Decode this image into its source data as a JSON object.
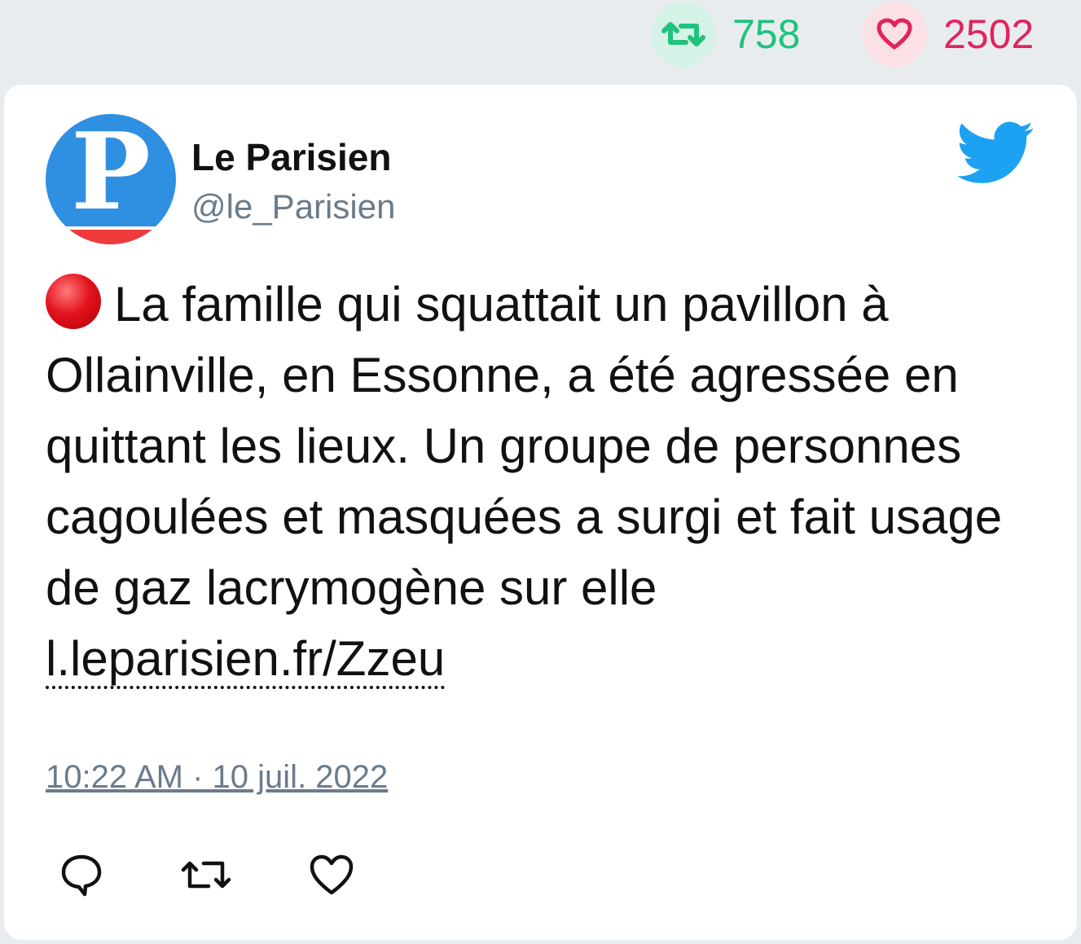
{
  "stats": {
    "retweet_icon": "retweet-icon",
    "retweet_count": "758",
    "like_icon": "heart-icon",
    "like_count": "2502",
    "retweet_color": "#1fc27d",
    "like_color": "#e0245e"
  },
  "tweet": {
    "author_name": "Le Parisien",
    "author_handle": "@le_Parisien",
    "avatar_letter": "P",
    "platform_icon": "twitter-bird-icon",
    "emoji": "red-circle",
    "text": "La famille qui squattait un pavillon à Ollainville, en Essonne, a été agressée en quittant les lieux. Un groupe de personnes cagoulées et masquées a surgi et fait usage de gaz lacrymogène sur elle ",
    "link_text": "l.leparisien.fr/Zzeu",
    "timestamp": "10:22 AM · 10 juil. 2022",
    "accent_color": "#1da1f2"
  },
  "actions": [
    "reply-icon",
    "retweet-icon",
    "like-icon"
  ]
}
